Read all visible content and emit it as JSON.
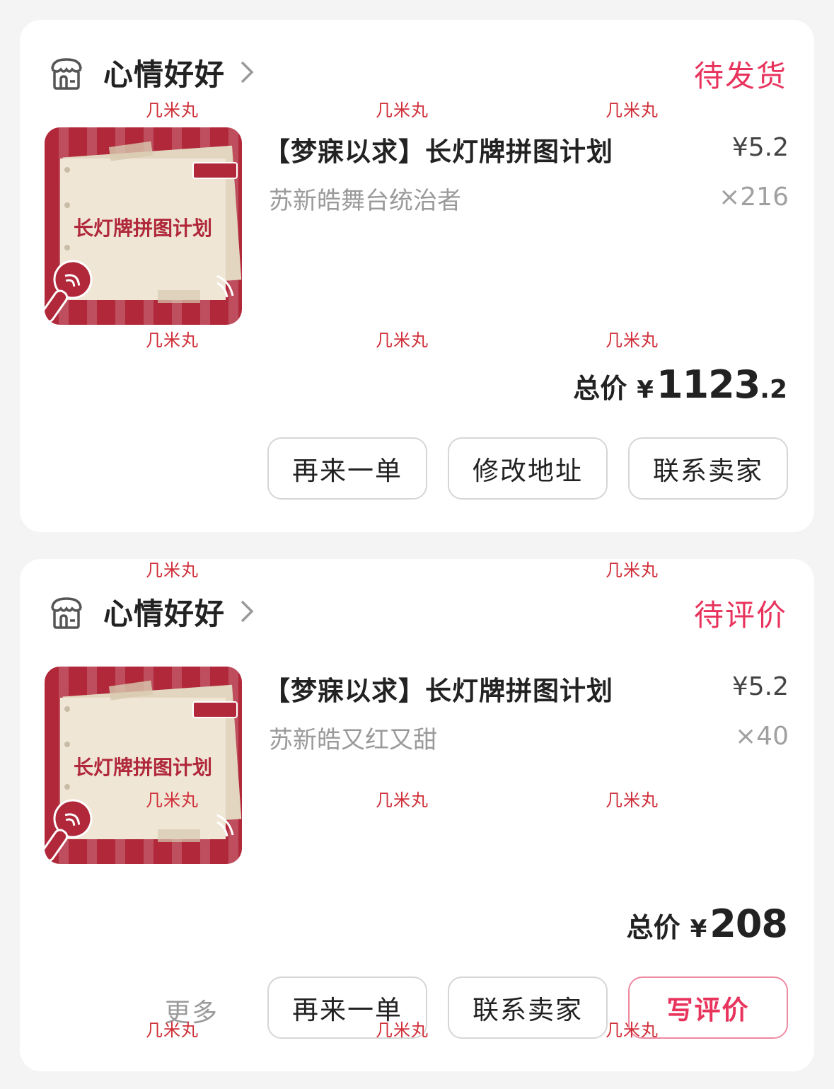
{
  "watermark": "几米丸",
  "orders": [
    {
      "shop_name": "心情好好",
      "status": "待发货",
      "product": {
        "title": "【梦寐以求】长灯牌拼图计划",
        "variant": "苏新皓舞台统治者",
        "price": "¥5.2",
        "quantity": "×216",
        "image_text": "长灯牌拼图计划"
      },
      "total": {
        "label": "总价",
        "currency": "¥",
        "integer": "1123",
        "decimal": ".2"
      },
      "actions": [
        "再来一单",
        "修改地址",
        "联系卖家"
      ]
    },
    {
      "shop_name": "心情好好",
      "status": "待评价",
      "product": {
        "title": "【梦寐以求】长灯牌拼图计划",
        "variant": "苏新皓又红又甜",
        "price": "¥5.2",
        "quantity": "×40",
        "image_text": "长灯牌拼图计划"
      },
      "total": {
        "label": "总价",
        "currency": "¥",
        "integer": "208",
        "decimal": ""
      },
      "more_label": "更多",
      "actions": [
        "再来一单",
        "联系卖家",
        "写评价"
      ]
    }
  ],
  "colors": {
    "status": "#e8345d",
    "product_bg": "#b0283a",
    "paper": "#efe6d6"
  },
  "icons": {
    "shop": "store-icon",
    "chevron": "chevron-right-icon"
  }
}
